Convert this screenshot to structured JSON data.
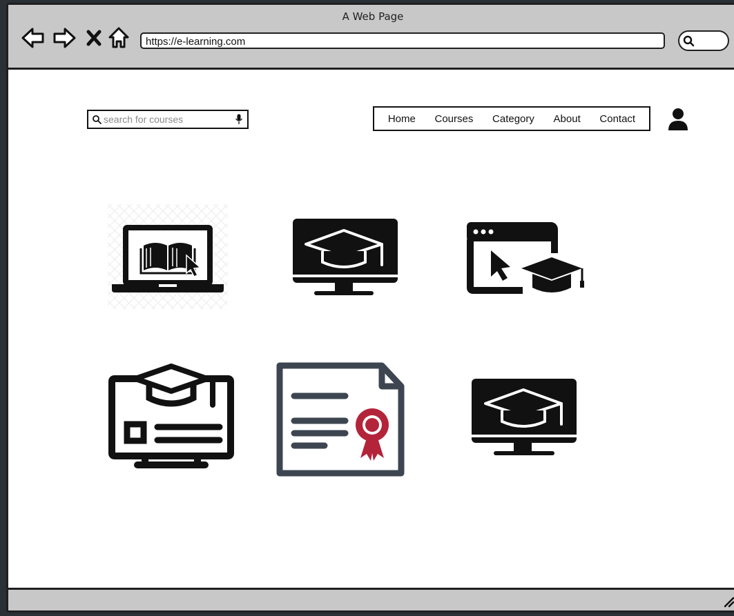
{
  "window": {
    "title": "A Web Page"
  },
  "browser": {
    "url": "https://e-learning.com",
    "icons": [
      "back-arrow-icon",
      "forward-arrow-icon",
      "close-x-icon",
      "home-icon",
      "search-icon"
    ]
  },
  "site_search": {
    "placeholder": "search for courses",
    "icons": [
      "search-icon",
      "microphone-icon"
    ]
  },
  "nav": {
    "items": [
      "Home",
      "Courses",
      "Category",
      "About",
      "Contact"
    ]
  },
  "user": {
    "icon": "user-icon"
  },
  "tiles": [
    {
      "icon": "laptop-book-icon"
    },
    {
      "icon": "monitor-graduation-cap-icon"
    },
    {
      "icon": "browser-cursor-graduation-cap-icon"
    },
    {
      "icon": "monitor-cap-profile-icon"
    },
    {
      "icon": "certificate-icon"
    },
    {
      "icon": "monitor-graduation-cap-icon"
    }
  ],
  "colors": {
    "certificate_outline": "#3d4650",
    "certificate_seal": "#b3243a",
    "chrome": "#c8c8c8"
  }
}
